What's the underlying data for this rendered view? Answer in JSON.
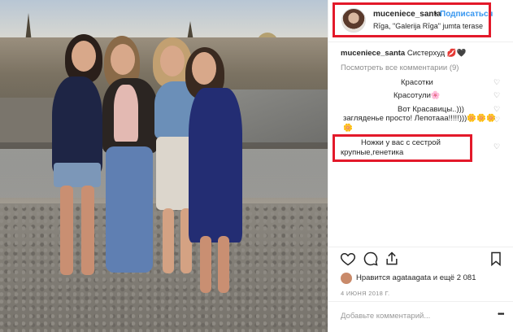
{
  "post": {
    "username": "muceniece_santa",
    "follow_label": "Подписаться",
    "separator": "•",
    "location": "Rīga, \"Galerija Rīga\" jumta terase",
    "caption_user": "muceniece_santa",
    "caption_text": "Систерхуд 💋🖤",
    "view_all_comments": "Посмотреть все комментарии (9)",
    "comments": [
      {
        "text": "Красотки"
      },
      {
        "text": "Красотули🌸"
      },
      {
        "text": "Вот Красавицы..)))"
      },
      {
        "text": "загляденье просто! Лепотааа!!!!!)))🌼🌼🌼"
      },
      {
        "text": "🌼"
      },
      {
        "text": "Ножки у вас с сестрой"
      },
      {
        "text": "крупные,генетика"
      }
    ],
    "likes_text": "Нравится agataagata и ещё 2 081",
    "date": "4 ИЮНЯ 2018 Г.",
    "comment_placeholder": "Добавьте комментарий...",
    "more_label": "•••"
  },
  "icons": {
    "heart": "heart-icon",
    "comment": "comment-icon",
    "share": "share-icon",
    "bookmark": "bookmark-icon"
  },
  "colors": {
    "accent": "#3897f0",
    "highlight": "#e3192a",
    "muted": "#8e8e8e"
  }
}
